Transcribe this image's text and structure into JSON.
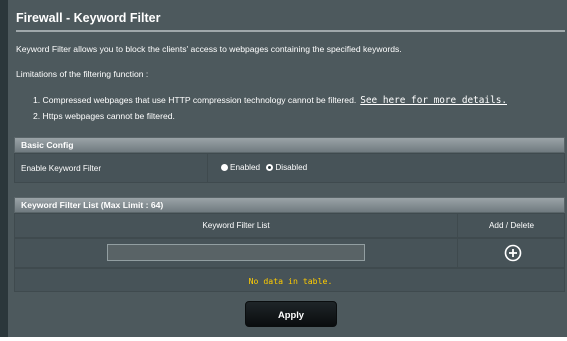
{
  "page": {
    "title": "Firewall - Keyword Filter"
  },
  "description": {
    "intro": "Keyword Filter allows you to block the clients' access to webpages containing the specified keywords.",
    "limitations_heading": "Limitations of the filtering function :",
    "limitation_1": "1. Compressed webpages that use HTTP compression technology cannot be filtered.",
    "limitation_1_link": "See here for more details.",
    "limitation_2": "2. Https webpages cannot be filtered."
  },
  "basic_config": {
    "header": "Basic Config",
    "enable_label": "Enable Keyword Filter",
    "options": [
      "Enabled",
      "Disabled"
    ],
    "selected": "Disabled"
  },
  "keyword_list": {
    "header": "Keyword Filter List (Max Limit : 64)",
    "columns": [
      "Keyword Filter List",
      "Add / Delete"
    ],
    "input_value": "",
    "empty_message": "No data in table."
  },
  "actions": {
    "apply_label": "Apply"
  },
  "colors": {
    "panel_bg": "#4d595d",
    "frame_bg": "#2b373b",
    "empty_text": "#ffcc00"
  },
  "icons": {
    "add": "plus-circle-icon"
  }
}
